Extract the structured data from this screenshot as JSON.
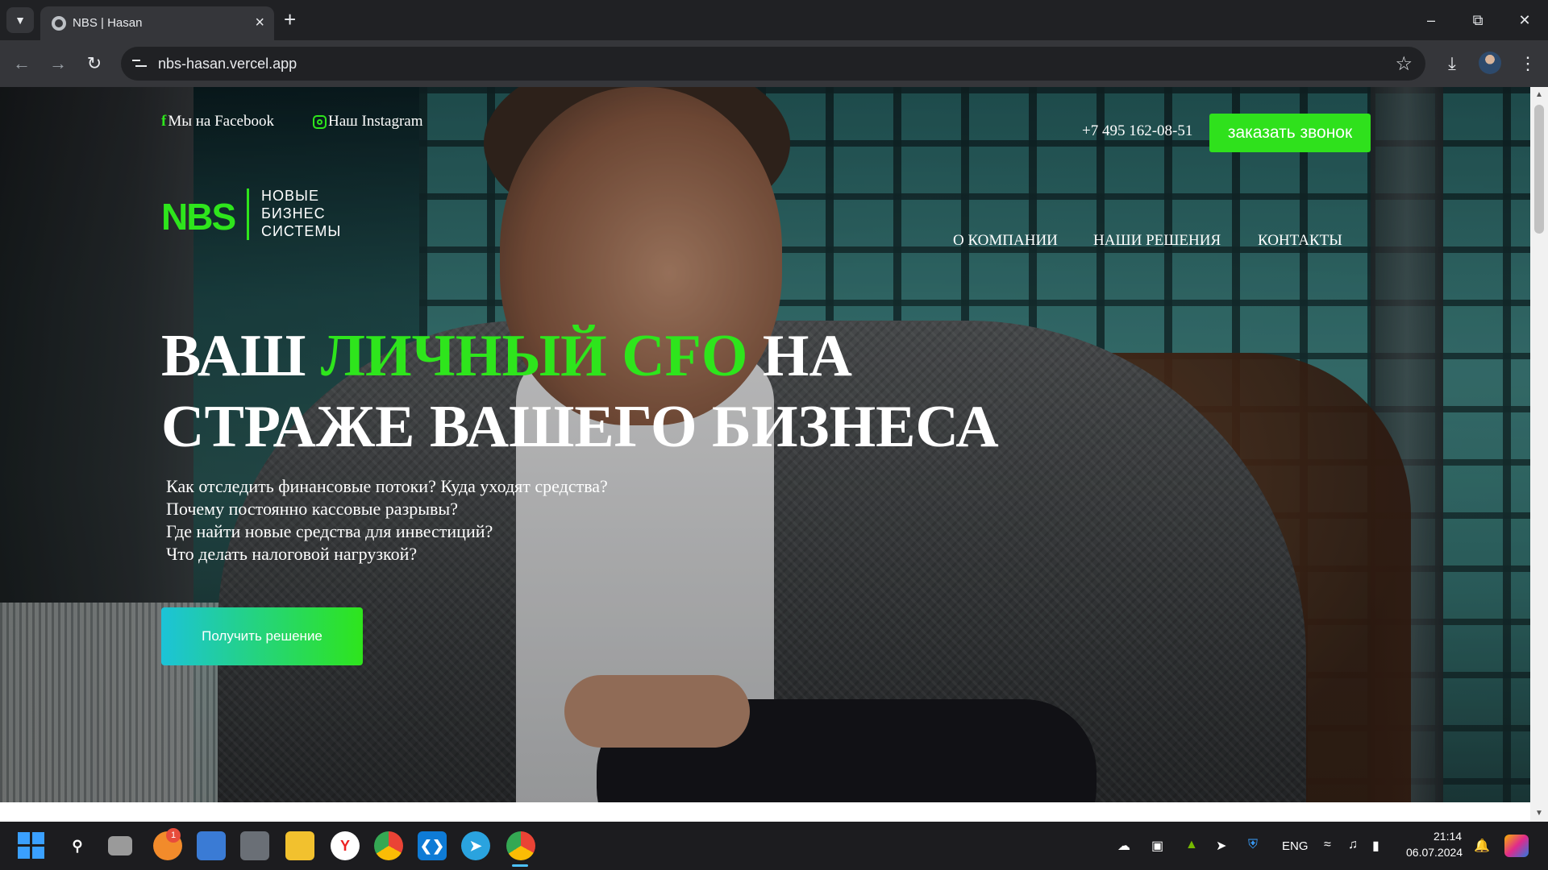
{
  "browser": {
    "tab_title": "NBS | Hasan",
    "url": "nbs-hasan.vercel.app"
  },
  "page": {
    "social": {
      "facebook": "Мы на Facebook",
      "instagram": "Наш Instagram"
    },
    "phone": "+7 495 162-08-51",
    "callback_button": "заказать звонок",
    "logo": {
      "mark": "NBS",
      "line1": "НОВЫЕ",
      "line2": "БИЗНЕС",
      "line3": "СИСТЕМЫ"
    },
    "nav": {
      "about": "О КОМПАНИИ",
      "solutions": "НАШИ РЕШЕНИЯ",
      "contacts": "КОНТАКТЫ"
    },
    "headline": {
      "part1": "ВАШ ",
      "accent": "ЛИЧНЫЙ CFO",
      "part2": " НА",
      "line2": "СТРАЖЕ ВАШЕГО БИЗНЕСА"
    },
    "questions": [
      "Как отследить финансовые потоки? Куда уходят средства?",
      "Почему постоянно кассовые разрывы?",
      "Где найти новые средства для инвестиций?",
      "Что делать налоговой нагрузкой?"
    ],
    "cta_button": "Получить решение",
    "colors": {
      "accent": "#2ee51c",
      "gradient_start": "#1cc3d8"
    }
  },
  "taskbar": {
    "badge_count": "1",
    "language": "ENG",
    "time": "21:14",
    "date": "06.07.2024"
  }
}
